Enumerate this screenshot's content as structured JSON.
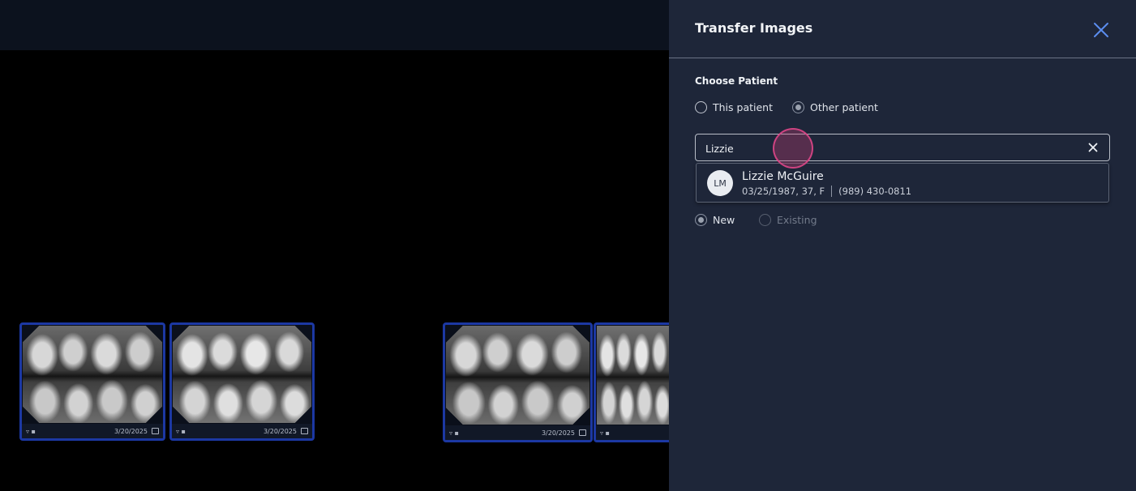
{
  "panel": {
    "title": "Transfer Images",
    "choose_patient_label": "Choose Patient",
    "patient_options": [
      {
        "label": "This patient",
        "selected": false
      },
      {
        "label": "Other patient",
        "selected": true
      }
    ],
    "search": {
      "value": "Lizzie",
      "placeholder": ""
    },
    "results": [
      {
        "initials": "LM",
        "name": "Lizzie McGuire",
        "dob_age_sex": "03/25/1987, 37, F",
        "phone": "(989) 430-0811"
      }
    ],
    "exam_options": [
      {
        "label": "New",
        "selected": true,
        "disabled": false
      },
      {
        "label": "Existing",
        "selected": false,
        "disabled": true
      }
    ]
  },
  "thumbnails": [
    {
      "date": "3/20/2025",
      "tooth_label": "▿ ▪"
    },
    {
      "date": "3/20/2025",
      "tooth_label": "▿ ▪"
    },
    {
      "date": "3/20/2025",
      "tooth_label": "▿ ▪"
    },
    {
      "date": "",
      "tooth_label": "▿ ▪"
    }
  ],
  "icons": {
    "close": "close-icon",
    "clear": "clear-icon",
    "tooth": "tooth-icon",
    "format": "format-icon"
  },
  "colors": {
    "panel_bg": "#1e2639",
    "thumb_border": "#1c38a3",
    "cursor_accent": "#dc4687"
  }
}
